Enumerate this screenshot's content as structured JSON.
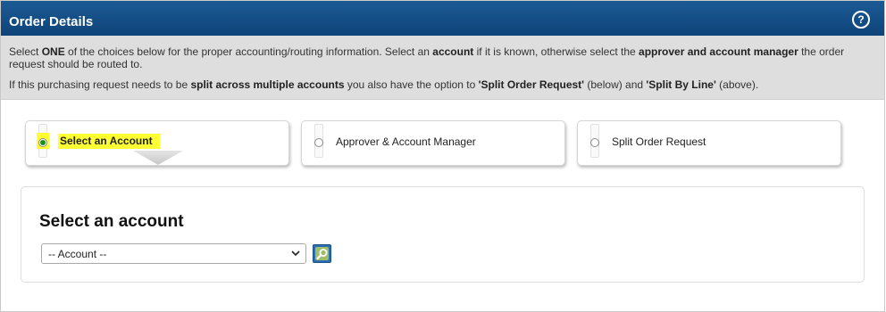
{
  "header": {
    "title": "Order Details",
    "help_label": "?"
  },
  "info": {
    "line1": {
      "t1": "Select ",
      "b1": "ONE",
      "t2": " of the choices below for the proper accounting/routing information. Select an ",
      "b2": "account",
      "t3": " if it is known, otherwise select the ",
      "b3": "approver and account manager",
      "t4": " the order request should be routed to."
    },
    "line2": {
      "t1": "If this purchasing request needs to be ",
      "b1": "split across multiple accounts",
      "t2": " you also have the option to ",
      "b2": "'Split Order Request'",
      "t3": " (below) and ",
      "b3": "'Split By Line'",
      "t4": " (above)."
    }
  },
  "choices": [
    {
      "label": "Select an Account",
      "selected": true
    },
    {
      "label": "Approver & Account Manager",
      "selected": false
    },
    {
      "label": "Split Order Request",
      "selected": false
    }
  ],
  "account_section": {
    "title": "Select an account",
    "select_value": "-- Account --"
  },
  "colors": {
    "header": "#0e4479",
    "highlight": "#ffff33",
    "radio_selected": "#1a8f1a",
    "search_button": "#2c6fb0"
  },
  "icons": {
    "help": "question-circle-icon",
    "dropdown": "chevron-down-icon",
    "search": "magnifier-icon",
    "arrow": "down-arrow-icon"
  }
}
